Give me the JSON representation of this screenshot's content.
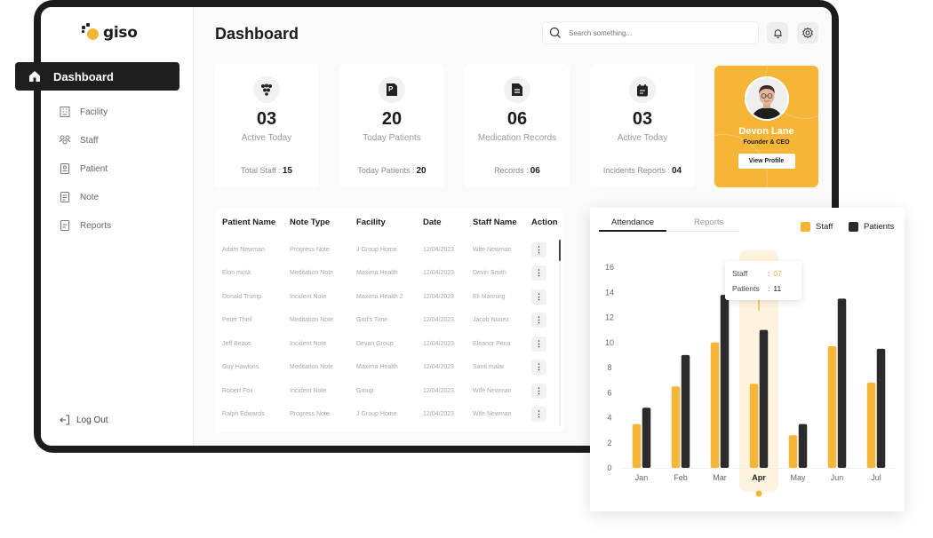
{
  "brand": {
    "logo_text": "giso"
  },
  "sidebar": {
    "active": {
      "label": "Dashboard"
    },
    "items": [
      {
        "label": "Facility"
      },
      {
        "label": "Staff"
      },
      {
        "label": "Patient"
      },
      {
        "label": "Note"
      },
      {
        "label": "Reports"
      }
    ],
    "logout_label": "Log Out"
  },
  "header": {
    "title": "Dashboard",
    "search_placeholder": "Search something..."
  },
  "stats": [
    {
      "value": "03",
      "label": "Active Today",
      "footer_label": "Total Staff :",
      "footer_value": "15"
    },
    {
      "value": "20",
      "label": "Today Patients",
      "footer_label": "Today Patients :",
      "footer_value": "20"
    },
    {
      "value": "06",
      "label": "Medication Records",
      "footer_label": "Records :",
      "footer_value": "06"
    },
    {
      "value": "03",
      "label": "Active Today",
      "footer_label": "Incidents Reports :",
      "footer_value": "04"
    }
  ],
  "profile": {
    "name": "Devon Lane",
    "role": "Founder & CEO",
    "button_label": "View Profile"
  },
  "table": {
    "headers": [
      "Patient Name",
      "Note Type",
      "Facility",
      "Date",
      "Staff Name",
      "Action"
    ],
    "action_symbol": "⋮",
    "rows": [
      [
        "Adam Newman",
        "Progress Note",
        "J Group Home",
        "12/04/2023",
        "Wife Newman"
      ],
      [
        "Elon musk",
        "Meditation  Note",
        "Maxima Health",
        "12/04/2023",
        "Devin Smith"
      ],
      [
        "Donald Trump",
        "Incident Note",
        "Maxima Health 2",
        "12/04/2023",
        "Eli Manning"
      ],
      [
        "Peter Theil",
        "Meditation  Note",
        "God's Time",
        "12/04/2023",
        "Jacob Nunez"
      ],
      [
        "Jeff Bezos",
        "Incident Note",
        "Devan Group",
        "12/04/2023",
        "Eleanor Pena"
      ],
      [
        "Guy Hawkins",
        "Meditation  Note",
        "Maxima Health",
        "12/04/2023",
        "Santi malar"
      ],
      [
        "Robert Fox",
        "Incident Note",
        "Group",
        "12/04/2023",
        "Wife Newman"
      ],
      [
        "Ralph Edwards",
        "Progress Note",
        "J Group Home",
        "12/04/2023",
        "Wife Newman"
      ]
    ]
  },
  "chart_tabs": [
    {
      "label": "Attendance",
      "active": true
    },
    {
      "label": "Reports",
      "active": false
    }
  ],
  "tooltip": {
    "staff_label": "Staff",
    "staff_value": "07",
    "patients_label": "Patients",
    "patients_value": "11",
    "separator": ":"
  },
  "colors": {
    "accent": "#f5b638",
    "dark": "#2b2b2b",
    "frame": "#1c1c1c"
  },
  "chart_data": {
    "type": "bar",
    "categories": [
      "Jan",
      "Feb",
      "Mar",
      "Apr",
      "May",
      "Jun",
      "Jul"
    ],
    "series": [
      {
        "name": "Staff",
        "color": "#f5b638",
        "values": [
          3.5,
          6.5,
          10,
          6.7,
          2.6,
          9.7,
          6.8
        ]
      },
      {
        "name": "Patients",
        "color": "#2b2b2b",
        "values": [
          4.8,
          9,
          13.8,
          11,
          3.5,
          13.5,
          9.5
        ]
      }
    ],
    "yticks": [
      0,
      2,
      4,
      6,
      8,
      10,
      12,
      14,
      16
    ],
    "ylim": [
      0,
      16
    ],
    "highlight_category": "Apr",
    "legend_position": "top-right",
    "grid": false
  }
}
